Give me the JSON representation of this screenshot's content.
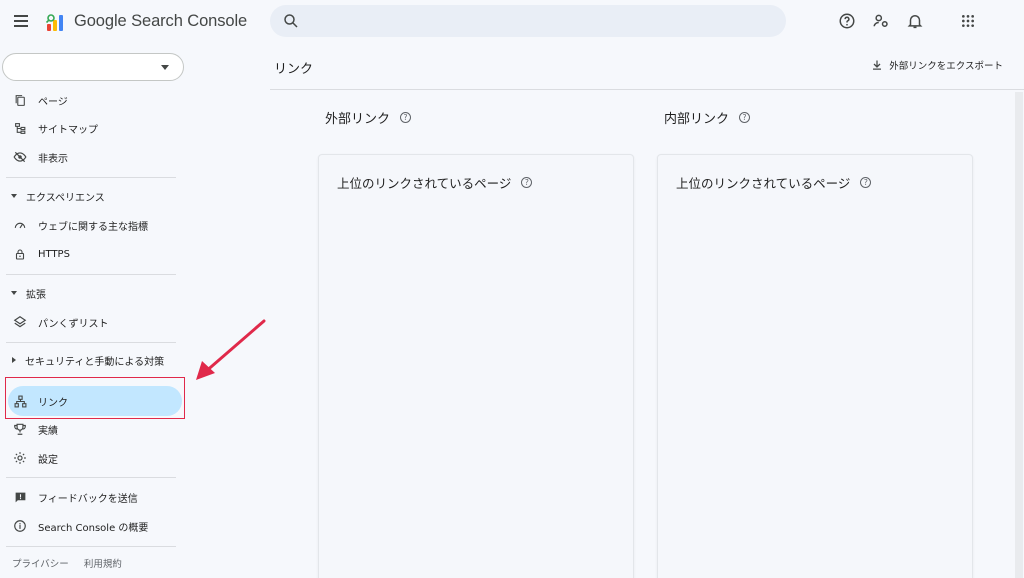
{
  "app": {
    "brand": "Google Search Console"
  },
  "search": {
    "placeholder": ""
  },
  "topbar_icons": [
    "help-icon",
    "manage-users-icon",
    "notifications-icon",
    "apps-grid-icon"
  ],
  "sidebar": {
    "property_selector_value": "",
    "items_top": [
      {
        "label": "ページ",
        "icon": "pages-icon"
      },
      {
        "label": "サイトマップ",
        "icon": "sitemap-icon"
      },
      {
        "label": "非表示",
        "icon": "hidden-icon"
      }
    ],
    "section_experience": {
      "label": "エクスペリエンス",
      "items": [
        {
          "label": "ウェブに関する主な指標",
          "icon": "gauge-icon"
        },
        {
          "label": "HTTPS",
          "icon": "lock-icon"
        }
      ]
    },
    "section_enhancements": {
      "label": "拡張",
      "items": [
        {
          "label": "パンくずリスト",
          "icon": "layers-icon"
        }
      ]
    },
    "section_security": {
      "label": "セキュリティと手動による対策"
    },
    "items_bottom": [
      {
        "label": "リンク",
        "icon": "links-icon",
        "active": true
      },
      {
        "label": "実績",
        "icon": "trophy-icon"
      },
      {
        "label": "設定",
        "icon": "gear-icon"
      }
    ],
    "items_footer": [
      {
        "label": "フィードバックを送信",
        "icon": "feedback-icon"
      },
      {
        "label": "Search Console の概要",
        "icon": "info-icon"
      }
    ],
    "legal": [
      "プライバシー",
      "利用規約"
    ]
  },
  "main": {
    "page_title": "リンク",
    "export_label": "外部リンクをエクスポート",
    "external": {
      "heading": "外部リンク",
      "card_title": "上位のリンクされているページ"
    },
    "internal": {
      "heading": "内部リンク",
      "card_title": "上位のリンクされているページ"
    }
  },
  "colors": {
    "accent_active": "#c2e7ff",
    "annotation_red": "#e0294a",
    "background": "#f6f8fc"
  }
}
